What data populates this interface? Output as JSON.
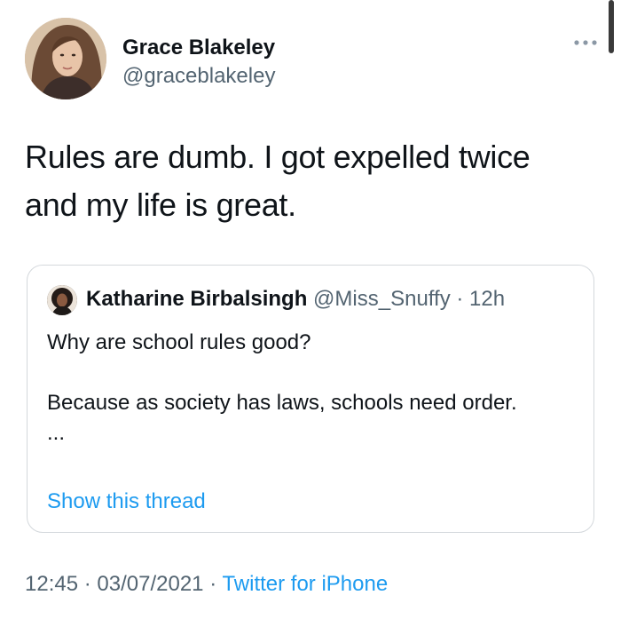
{
  "author": {
    "display_name": "Grace Blakeley",
    "handle": "@graceblakeley",
    "avatar": "avatar-photo"
  },
  "more_icon": "more-horizontal-icon",
  "tweet": {
    "line1": "Rules are dumb. I got expelled twice",
    "line2": "and my life is great."
  },
  "quote": {
    "display_name": "Katharine Birbalsingh",
    "handle": "@Miss_Snuffy",
    "separator": "·",
    "time": "12h",
    "paragraph1": "Why are school rules good?",
    "paragraph2": "Because as society has laws, schools need order.",
    "ellipsis": "...",
    "show_thread": "Show this thread"
  },
  "footer": {
    "time": "12:45",
    "separator": "·",
    "date": "03/07/2021",
    "source": "Twitter for iPhone"
  },
  "colors": {
    "text": "#0f1419",
    "secondary": "#536471",
    "link": "#1d9bf0",
    "border": "#d4d8dc"
  }
}
